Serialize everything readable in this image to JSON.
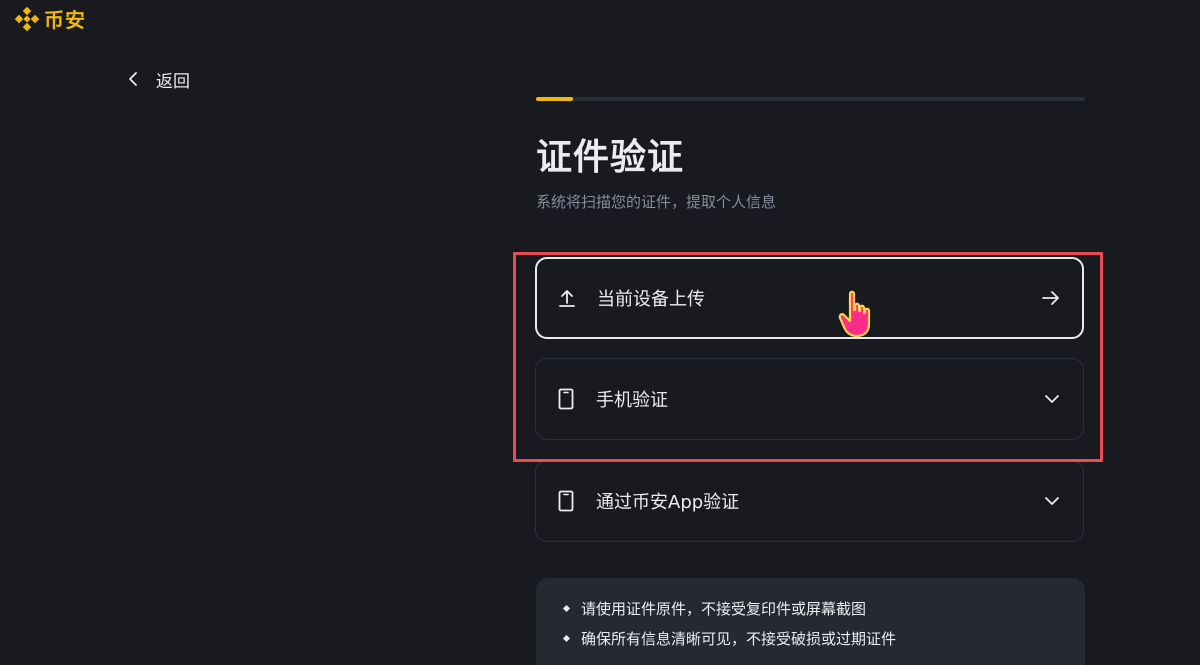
{
  "brand": {
    "name": "币安",
    "icon": "binance-logo-icon",
    "color": "#f0b90b"
  },
  "nav": {
    "back_label": "返回",
    "back_icon": "chevron-left-icon"
  },
  "progress": {
    "value": 0.067,
    "fill_color": "#f0b90b"
  },
  "page": {
    "title": "证件验证",
    "subtitle": "系统将扫描您的证件，提取个人信息"
  },
  "options": [
    {
      "label": "当前设备上传",
      "icon": "upload-icon",
      "right_icon": "arrow-right-icon",
      "selected": true
    },
    {
      "label": "手机验证",
      "icon": "phone-icon",
      "right_icon": "chevron-down-icon",
      "selected": false
    },
    {
      "label": "通过币安App验证",
      "icon": "phone-icon",
      "right_icon": "chevron-down-icon",
      "selected": false
    }
  ],
  "tips": [
    "请使用证件原件，不接受复印件或屏幕截图",
    "确保所有信息清晰可见，不接受破损或过期证件"
  ],
  "colors": {
    "background": "#181a20",
    "highlight": "#e94b55",
    "card_border": "#2b3139"
  }
}
